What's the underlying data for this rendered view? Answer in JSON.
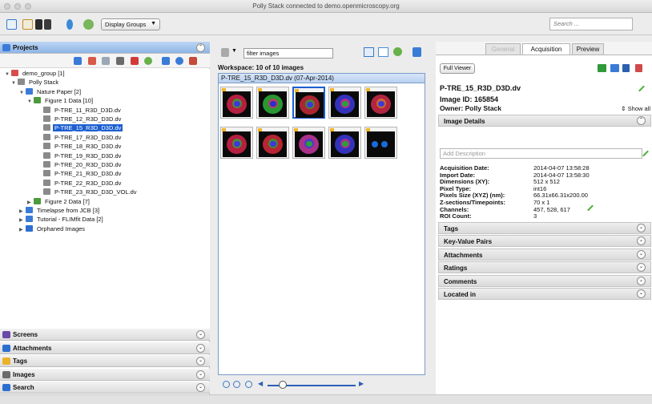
{
  "window": {
    "title": "Polly Stack connected to demo.openmicroscopy.org"
  },
  "toolbar": {
    "display_groups_label": "Display Groups",
    "search_placeholder": "Search ..."
  },
  "left_panel": {
    "projects_label": "Projects",
    "tree": [
      {
        "label": "demo_group [1]",
        "toggle": "▼",
        "icon_color": "#d94c4c"
      },
      {
        "label": "Polly Stack",
        "toggle": "▼",
        "icon_color": "#8b8b8b"
      },
      {
        "label": "Nature Paper [2]",
        "toggle": "▼",
        "icon_color": "#3b7bd8"
      },
      {
        "label": "Figure 1 Data [10]",
        "toggle": "▼",
        "icon_color": "#4c9a3c"
      },
      {
        "label": "P-TRE_11_R3D_D3D.dv",
        "toggle": "",
        "icon_color": "#8a8a8a"
      },
      {
        "label": "P-TRE_12_R3D_D3D.dv",
        "toggle": "",
        "icon_color": "#8a8a8a"
      },
      {
        "label": "P-TRE_15_R3D_D3D.dv",
        "toggle": "",
        "icon_color": "#8a8a8a"
      },
      {
        "label": "P-TRE_17_R3D_D3D.dv",
        "toggle": "",
        "icon_color": "#8a8a8a"
      },
      {
        "label": "P-TRE_18_R3D_D3D.dv",
        "toggle": "",
        "icon_color": "#8a8a8a"
      },
      {
        "label": "P-TRE_19_R3D_D3D.dv",
        "toggle": "",
        "icon_color": "#8a8a8a"
      },
      {
        "label": "P-TRE_20_R3D_D3D.dv",
        "toggle": "",
        "icon_color": "#8a8a8a"
      },
      {
        "label": "P-TRE_21_R3D_D3D.dv",
        "toggle": "",
        "icon_color": "#8a8a8a"
      },
      {
        "label": "P-TRE_22_R3D_D3D.dv",
        "toggle": "",
        "icon_color": "#8a8a8a"
      },
      {
        "label": "P-TRE_23_R3D_D3D_VOL.dv",
        "toggle": "",
        "icon_color": "#8a8a8a"
      },
      {
        "label": "Figure 2 Data [7]",
        "toggle": "▶",
        "icon_color": "#4c9a3c"
      },
      {
        "label": "Timelapse from JCB [3]",
        "toggle": "▶",
        "icon_color": "#3b7bd8"
      },
      {
        "label": "Tutorial - FLIMfit Data [2]",
        "toggle": "▶",
        "icon_color": "#3b7bd8"
      },
      {
        "label": "Orphaned Images",
        "toggle": "▶",
        "icon_color": "#2d6fd0"
      }
    ],
    "selected_index": 6,
    "bottom_sections": [
      {
        "label": "Screens",
        "icon_color": "#6a4aa8"
      },
      {
        "label": "Attachments",
        "icon_color": "#2d6fd0"
      },
      {
        "label": "Tags",
        "icon_color": "#e8b32a"
      },
      {
        "label": "Images",
        "icon_color": "#6b6b6b"
      },
      {
        "label": "Search",
        "icon_color": "#2d6fd0"
      }
    ]
  },
  "center_panel": {
    "filter_text": "filter  images",
    "workspace_label": "Workspace: 10 of 10 images",
    "group_title": "P-TRE_15_R3D_D3D.dv (07-Apr-2014)",
    "thumbnail_count": 10,
    "selected_thumbnail": 2
  },
  "right_panel": {
    "tabs": [
      {
        "label": "General",
        "state": "dim"
      },
      {
        "label": "Acquisition",
        "state": "active"
      },
      {
        "label": "Preview",
        "state": "normal"
      }
    ],
    "full_viewer_label": "Full Viewer",
    "image_name": "P-TRE_15_R3D_D3D.dv",
    "image_id_text": "Image ID: 165854",
    "owner_text": "Owner: Polly Stack",
    "show_all_label": "Show all",
    "image_details_label": "Image Details",
    "description_placeholder": "Add Description",
    "details": [
      {
        "key": "Acquisition Date:",
        "value": "2014-04-07 13:58:28"
      },
      {
        "key": "Import Date:",
        "value": "2014-04-07 13:58:30"
      },
      {
        "key": "Dimensions (XY):",
        "value": "512 x 512"
      },
      {
        "key": "Pixel Type:",
        "value": "int16"
      },
      {
        "key": "Pixels Size (XYZ) (nm):",
        "value": "66.31x66.31x200.00"
      },
      {
        "key": "Z-sections/Timepoints:",
        "value": "70 x 1"
      },
      {
        "key": "Channels:",
        "value": "457, 528, 617"
      },
      {
        "key": "ROI Count:",
        "value": "3"
      }
    ],
    "sections": [
      "Tags",
      "Key-Value Pairs",
      "Attachments",
      "Ratings",
      "Comments",
      "Located in"
    ]
  }
}
